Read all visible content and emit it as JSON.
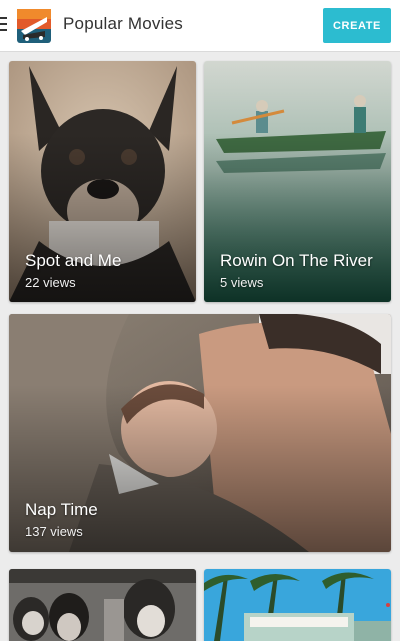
{
  "header": {
    "title": "Popular Movies",
    "create_label": "CREATE",
    "accent_color": "#2cbcd0",
    "icons": [
      "menu-icon",
      "app-logo"
    ]
  },
  "cards": [
    {
      "title": "Spot and Me",
      "views": "22 views"
    },
    {
      "title": "Rowin On The River",
      "views": "5 views"
    },
    {
      "title": "Nap Time",
      "views": "137 views"
    },
    {
      "title": "",
      "views": ""
    },
    {
      "title": "",
      "views": ""
    }
  ]
}
